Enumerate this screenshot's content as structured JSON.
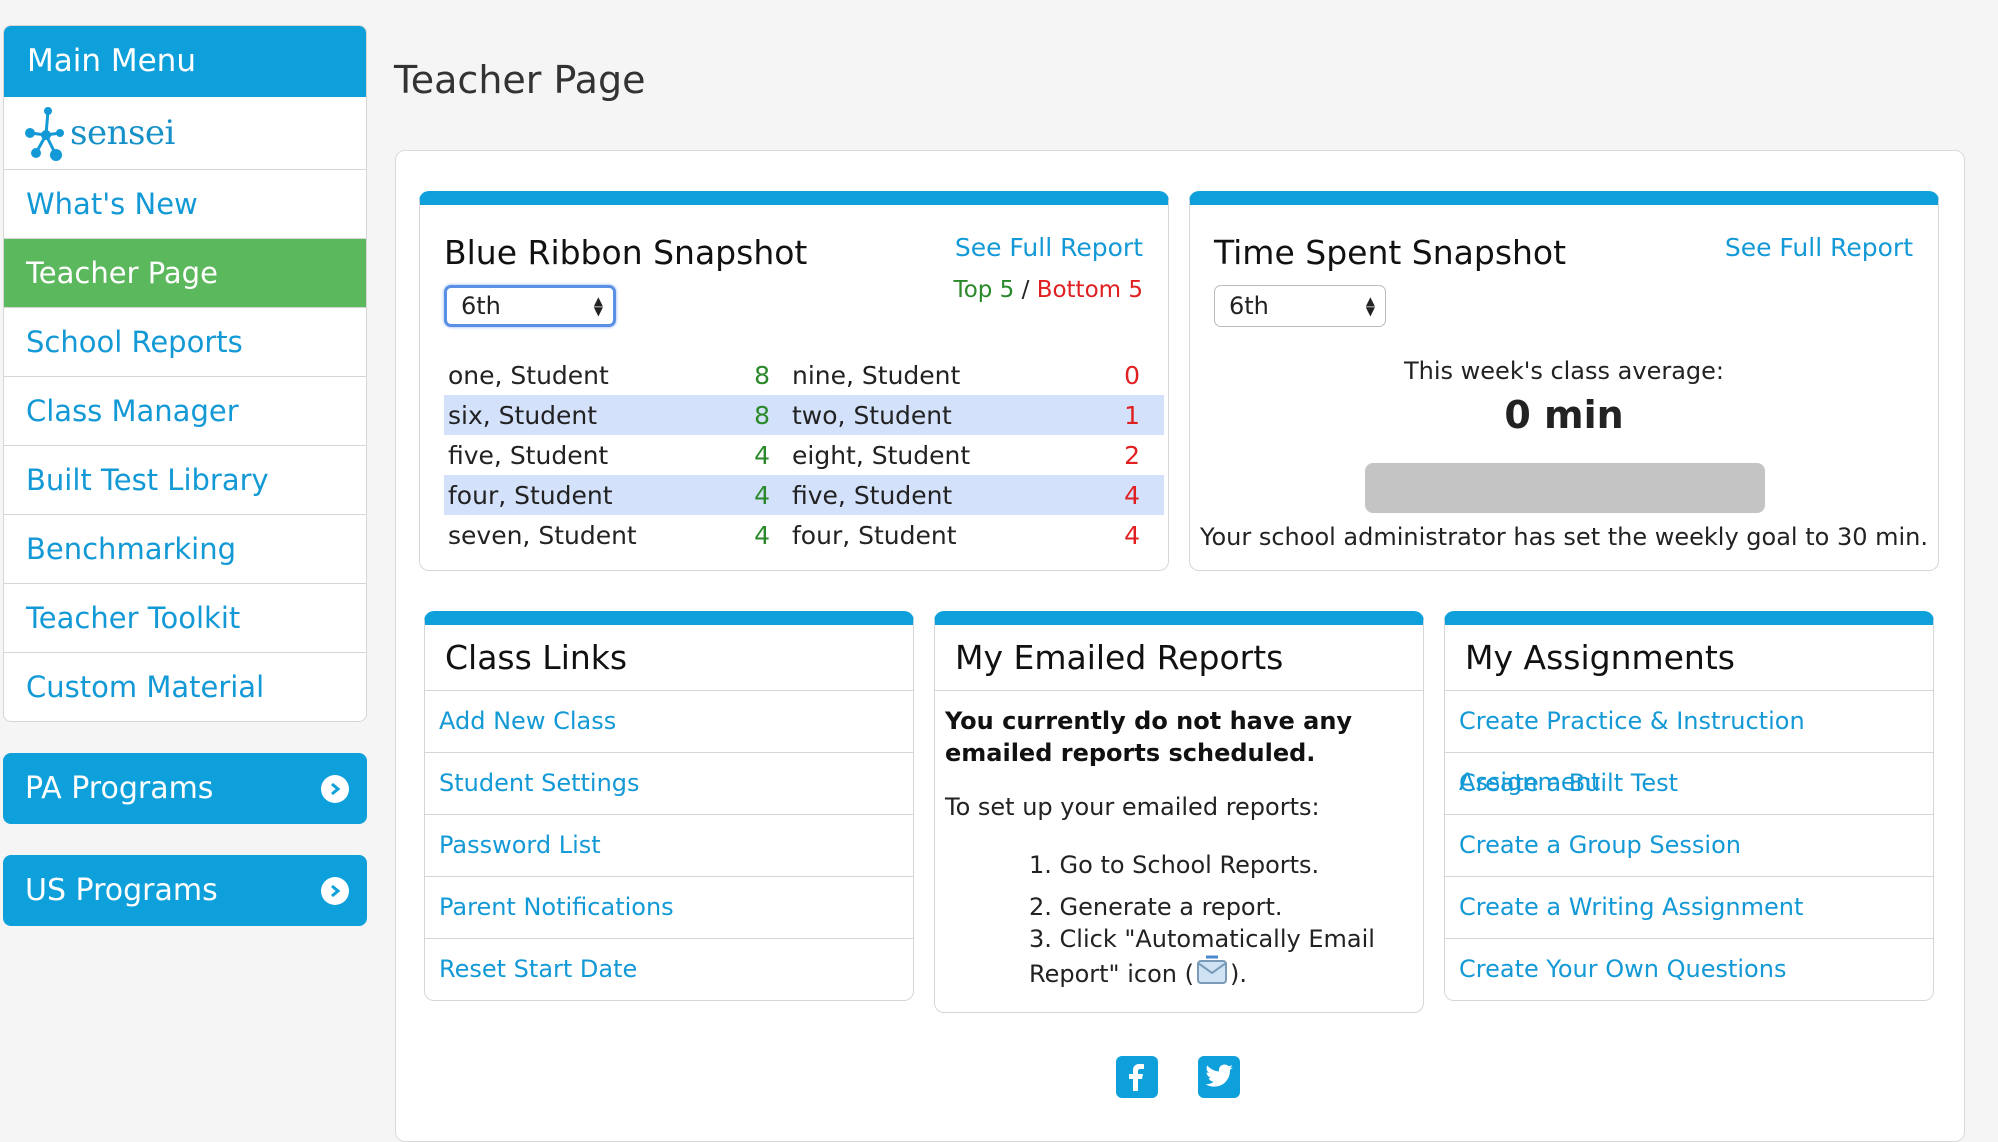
{
  "sidebar": {
    "header": "Main Menu",
    "logo_text": "sensei",
    "items": [
      {
        "label": "What's New"
      },
      {
        "label": "Teacher Page"
      },
      {
        "label": "School Reports"
      },
      {
        "label": "Class Manager"
      },
      {
        "label": "Built Test Library"
      },
      {
        "label": "Benchmarking"
      },
      {
        "label": "Teacher Toolkit"
      },
      {
        "label": "Custom Material"
      }
    ],
    "programs": [
      {
        "label": "PA Programs"
      },
      {
        "label": "US Programs"
      }
    ]
  },
  "page": {
    "title": "Teacher Page"
  },
  "blue_ribbon": {
    "title": "Blue Ribbon Snapshot",
    "see_full": "See Full Report",
    "grade": "6th",
    "top_label": "Top 5",
    "separator": " / ",
    "bottom_label": "Bottom 5",
    "top": [
      {
        "name": "one, Student",
        "value": "8"
      },
      {
        "name": "six, Student",
        "value": "8"
      },
      {
        "name": "five, Student",
        "value": "4"
      },
      {
        "name": "four, Student",
        "value": "4"
      },
      {
        "name": "seven, Student",
        "value": "4"
      }
    ],
    "bottom": [
      {
        "name": "nine, Student",
        "value": "0"
      },
      {
        "name": "two, Student",
        "value": "1"
      },
      {
        "name": "eight, Student",
        "value": "2"
      },
      {
        "name": "five, Student",
        "value": "4"
      },
      {
        "name": "four, Student",
        "value": "4"
      }
    ]
  },
  "time_spent": {
    "title": "Time Spent Snapshot",
    "see_full": "See Full Report",
    "grade": "6th",
    "avg_label": "This week's class average:",
    "avg_value": "0 min",
    "progress": 0,
    "goal_text": "Your school administrator has set the weekly goal to 30 min."
  },
  "class_links": {
    "title": "Class Links",
    "items": [
      "Add New Class",
      "Student Settings",
      "Password List",
      "Parent Notifications",
      "Reset Start Date"
    ]
  },
  "emailed_reports": {
    "title": "My Emailed Reports",
    "notice": "You currently do not have any emailed reports scheduled.",
    "setup": "To set up your emailed reports:",
    "step1": "1. Go to School Reports.",
    "step2": "2. Generate a report.",
    "step3a": "3. Click \"Automatically Email",
    "step3b": "Report\" icon (",
    "step3c": ")."
  },
  "assignments": {
    "title": "My Assignments",
    "items": [
      "Create Practice & Instruction Assignment",
      "Create a Built Test",
      "Create a Group Session",
      "Create a Writing Assignment",
      "Create Your Own Questions"
    ]
  },
  "social": {
    "icons": [
      "facebook-icon",
      "twitter-icon"
    ]
  },
  "colors": {
    "primary": "#0ea0db",
    "active": "#5cb85c",
    "link": "#1399d6",
    "top": "#2a8a2a",
    "bottom": "#e02020",
    "row_highlight": "#d3e1fa"
  }
}
